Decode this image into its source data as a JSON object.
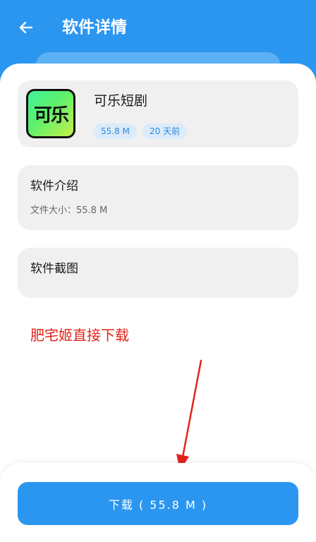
{
  "header": {
    "title": "软件详情",
    "back_icon": "arrow-left-icon"
  },
  "app": {
    "name": "可乐短剧",
    "icon_text": "可乐",
    "size_tag": "55.8 M",
    "date_tag": "20 天前"
  },
  "intro": {
    "heading": "软件介绍",
    "text": "文件大小：55.8 M"
  },
  "screenshots": {
    "heading": "软件截图"
  },
  "promo_text": "肥宅姬直接下载",
  "download": {
    "label": "下载 ( 55.8 M )"
  },
  "colors": {
    "primary": "#2b96f0",
    "promo": "#e2231a",
    "tag_text": "#2b8ae0"
  }
}
